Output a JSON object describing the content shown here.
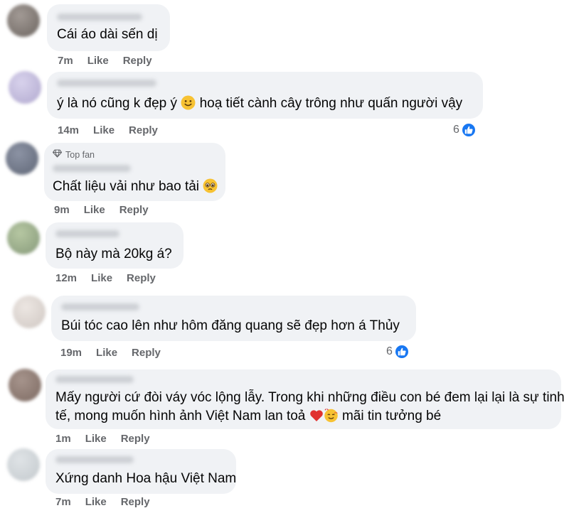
{
  "comments": [
    {
      "text": "Cái áo dài sến dị",
      "time": "7m",
      "like": "Like",
      "reply": "Reply",
      "reactions": ""
    },
    {
      "text": "ý là nó cũng k đẹp ý",
      "text_b": "hoạ tiết cành cây trông như quấn người vậy",
      "time": "14m",
      "like": "Like",
      "reply": "Reply",
      "reactions": "6"
    },
    {
      "badge": "Top fan",
      "text": "Chất liệu vải như bao tải",
      "time": "9m",
      "like": "Like",
      "reply": "Reply",
      "reactions": ""
    },
    {
      "text": "Bộ này mà 20kg á?",
      "time": "12m",
      "like": "Like",
      "reply": "Reply",
      "reactions": ""
    },
    {
      "text": "Búi tóc cao lên như hôm đăng quang sẽ đẹp hơn á Thủy",
      "time": "19m",
      "like": "Like",
      "reply": "Reply",
      "reactions": "6"
    },
    {
      "text": "Mấy người cứ đòi váy vóc lộng lẫy. Trong khi những điều con bé đem lại lại là sự tinh",
      "text_b": "tế, mong muốn hình ảnh Việt Nam lan toả",
      "text_c": "mãi tin tưởng bé",
      "time": "1m",
      "like": "Like",
      "reply": "Reply",
      "reactions": ""
    },
    {
      "text": "Xứng danh Hoa hậu Việt Nam",
      "time": "7m",
      "like": "Like",
      "reply": "Reply",
      "reactions": ""
    }
  ],
  "colors": {
    "bubble": "#f0f2f5",
    "meta": "#65676b",
    "like_blue": "#1877f2"
  },
  "icons": [
    "like-thumb-icon",
    "diamond-icon",
    "smile-emoji-icon",
    "pleading-emoji-icon",
    "red-heart-emoji-icon",
    "smiling-hearts-emoji-icon"
  ]
}
